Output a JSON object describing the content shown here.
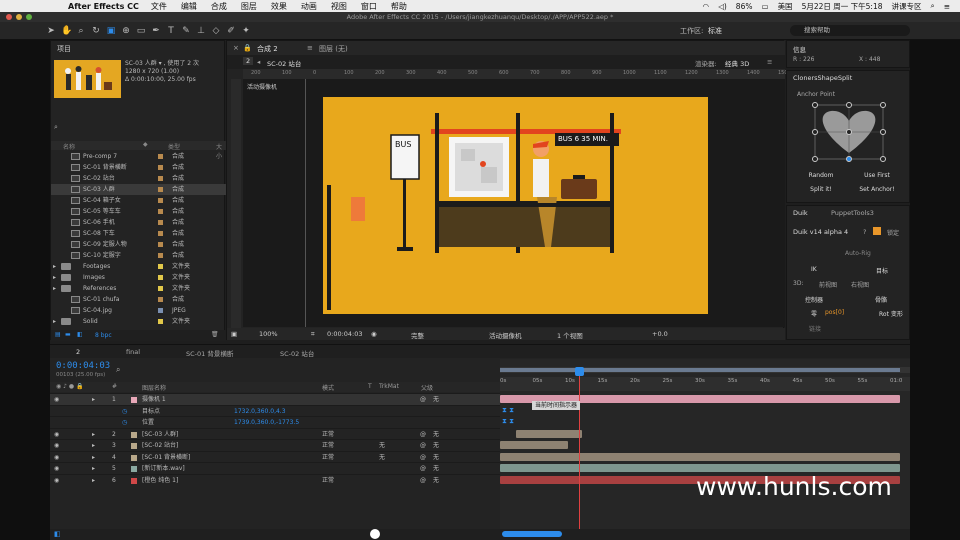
{
  "menubar": {
    "app": "After Effects CC",
    "items": [
      "文件",
      "编辑",
      "合成",
      "图层",
      "效果",
      "动画",
      "视图",
      "窗口",
      "帮助"
    ],
    "battery": "86%",
    "lang": "美国",
    "datetime": "5月22日 周一 下午5:18",
    "user": "讲课专区"
  },
  "window_title": "Adobe After Effects CC 2015 - /Users/jiangkezhuanqu/Desktop/./APP/APP522.aep *",
  "toolbar": {
    "workspace_label": "工作区:",
    "workspace_value": "标准",
    "search_placeholder": "搜索帮助"
  },
  "project": {
    "tab": "项目",
    "selected_name": "SC-03 人群 ▾ , 使用了 2 次",
    "size": "1280 x 720 (1.00)",
    "duration": "Δ 0:00:10:00, 25.00 fps",
    "col_name": "名称",
    "col_type": "类型",
    "col_size": "大小",
    "items": [
      {
        "name": "Pre-comp 7",
        "type": "合成",
        "color": "#b88a4e",
        "folder": false,
        "sel": false
      },
      {
        "name": "SC-01 背景横断",
        "type": "合成",
        "color": "#b88a4e",
        "folder": false,
        "sel": false
      },
      {
        "name": "SC-02 站台",
        "type": "合成",
        "color": "#b88a4e",
        "folder": false,
        "sel": false
      },
      {
        "name": "SC-03 人群",
        "type": "合成",
        "color": "#b88a4e",
        "folder": false,
        "sel": true
      },
      {
        "name": "SC-04 箱子女",
        "type": "合成",
        "color": "#b88a4e",
        "folder": false,
        "sel": false
      },
      {
        "name": "SC-05 等车车",
        "type": "合成",
        "color": "#b88a4e",
        "folder": false,
        "sel": false
      },
      {
        "name": "SC-06 手机",
        "type": "合成",
        "color": "#b88a4e",
        "folder": false,
        "sel": false
      },
      {
        "name": "SC-08 下车",
        "type": "合成",
        "color": "#b88a4e",
        "folder": false,
        "sel": false
      },
      {
        "name": "SC-09 定服人物",
        "type": "合成",
        "color": "#b88a4e",
        "folder": false,
        "sel": false
      },
      {
        "name": "SC-10 定服字",
        "type": "合成",
        "color": "#b88a4e",
        "folder": false,
        "sel": false
      },
      {
        "name": "Footages",
        "type": "文件夹",
        "color": "#e2c84a",
        "folder": true,
        "sel": false
      },
      {
        "name": "Images",
        "type": "文件夹",
        "color": "#e2c84a",
        "folder": true,
        "sel": false
      },
      {
        "name": "References",
        "type": "文件夹",
        "color": "#e2c84a",
        "folder": true,
        "sel": false
      },
      {
        "name": "SC-01 chufa",
        "type": "合成",
        "color": "#b88a4e",
        "folder": false,
        "sel": false
      },
      {
        "name": "SC-04.jpg",
        "type": "JPEG",
        "color": "#7a8fb0",
        "folder": false,
        "sel": false
      },
      {
        "name": "Solid",
        "type": "文件夹",
        "color": "#e2c84a",
        "folder": true,
        "sel": false
      }
    ],
    "bpc": "8 bpc"
  },
  "comp": {
    "tab_comp": "合成 2",
    "tab_layer": "图层 (无)",
    "sub_num": "2",
    "sub_name": "SC-02 站台",
    "renderer_label": "渲染器:",
    "renderer_value": "经典 3D",
    "camera_label": "活动摄像机",
    "ruler_ticks": [
      "200",
      "100",
      "0",
      "100",
      "200",
      "300",
      "400",
      "500",
      "600",
      "700",
      "800",
      "900",
      "1000",
      "1100",
      "1200",
      "1300",
      "1400",
      "1500"
    ],
    "scene": {
      "bus_sign": "BUS",
      "board": "BUS 6   35 MIN."
    },
    "footer": {
      "zoom": "100%",
      "time": "0:00:04:03",
      "quality": "完整",
      "camera": "活动摄像机",
      "views": "1 个视图",
      "exposure": "+0.0"
    }
  },
  "info": {
    "title": "信息",
    "r": "R : 226",
    "x": "X : 448"
  },
  "cloners": {
    "title": "ClonersShapeSplit",
    "anchor": "Anchor Point",
    "random": "Random",
    "use_first": "Use First",
    "split": "Split it!",
    "set_anchor": "Set Anchor!"
  },
  "duik": {
    "tab1": "Duik",
    "tab2": "PuppetTools3",
    "version": "Duik v14 alpha 4",
    "lock": "锁定",
    "autorig": "Auto-Rig",
    "ik": "IK",
    "target": "目标",
    "threed": "3D:",
    "front": "前视图",
    "right": "右视图",
    "controller": "控制器",
    "bone": "骨骼",
    "zero": "零",
    "pos0": "pos[0]",
    "rot": "Rot 变形",
    "link": "链接"
  },
  "timeline": {
    "tabs": [
      "2",
      "final",
      "SC-01 背景横断",
      "SC-02 站台"
    ],
    "time": "0:00:04:03",
    "fps": "00103 (25.00 fps)",
    "head_name": "图层名称",
    "head_mode": "模式",
    "head_t": "T",
    "head_trk": "TrkMat",
    "head_parent": "父级",
    "ruler": [
      "0s",
      "05s",
      "10s",
      "15s",
      "20s",
      "25s",
      "30s",
      "35s",
      "40s",
      "45s",
      "50s",
      "55s",
      "01:0"
    ],
    "tooltip": "当前时间指示器",
    "layers": [
      {
        "num": "1",
        "name": "摄像机 1",
        "color": "#e8a8b8",
        "mode": "",
        "trk": "",
        "parent": "无",
        "sel": true,
        "prop": false,
        "val": ""
      },
      {
        "num": "",
        "name": "目标点",
        "color": "",
        "mode": "",
        "trk": "",
        "parent": "",
        "sel": false,
        "prop": true,
        "val": "1732.0,360.0,4.3"
      },
      {
        "num": "",
        "name": "位置",
        "color": "",
        "mode": "",
        "trk": "",
        "parent": "",
        "sel": false,
        "prop": true,
        "val": "1739.0,360.0,-1773.5"
      },
      {
        "num": "2",
        "name": "[SC-03 人群]",
        "color": "#b8a88a",
        "mode": "正常",
        "trk": "",
        "parent": "无",
        "sel": false,
        "prop": false,
        "val": ""
      },
      {
        "num": "3",
        "name": "[SC-02 站台]",
        "color": "#b8a88a",
        "mode": "正常",
        "trk": "无",
        "parent": "无",
        "sel": false,
        "prop": false,
        "val": ""
      },
      {
        "num": "4",
        "name": "[SC-01 背景横断]",
        "color": "#b8a88a",
        "mode": "正常",
        "trk": "无",
        "parent": "无",
        "sel": false,
        "prop": false,
        "val": ""
      },
      {
        "num": "5",
        "name": "[新订新本.wav]",
        "color": "#8aa8a0",
        "mode": "",
        "trk": "",
        "parent": "无",
        "sel": false,
        "prop": false,
        "val": ""
      },
      {
        "num": "6",
        "name": "[橙色 纯色 1]",
        "color": "#d04848",
        "mode": "正常",
        "trk": "",
        "parent": "无",
        "sel": false,
        "prop": false,
        "val": ""
      }
    ]
  },
  "watermark": "www.hunls.com"
}
